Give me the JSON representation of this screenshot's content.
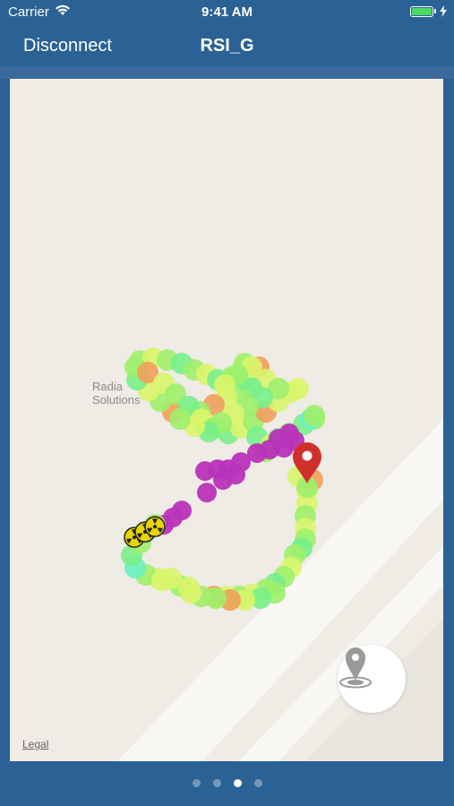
{
  "status_bar": {
    "carrier": "Carrier",
    "time": "9:41 AM",
    "battery_icon": "battery-full-icon",
    "wifi_icon": "wifi-icon"
  },
  "nav": {
    "left_label": "Disconnect",
    "title": "RSI_G"
  },
  "map": {
    "place_label_line1": "Radia",
    "place_label_line2": "Solutions",
    "legal": "Legal",
    "marker_icon": "map-pin-icon",
    "hazard_icon": "radiation-icon",
    "locate_icon": "location-pin-icon",
    "track_colors": [
      "#9ef06a",
      "#d9f56a",
      "#78f08a",
      "#f0a05a",
      "#b833b8",
      "#6cf0c0"
    ]
  },
  "pager": {
    "page_count": 4,
    "active_index": 2
  },
  "colors": {
    "header": "#2a6296",
    "marker": "#d0302a"
  }
}
